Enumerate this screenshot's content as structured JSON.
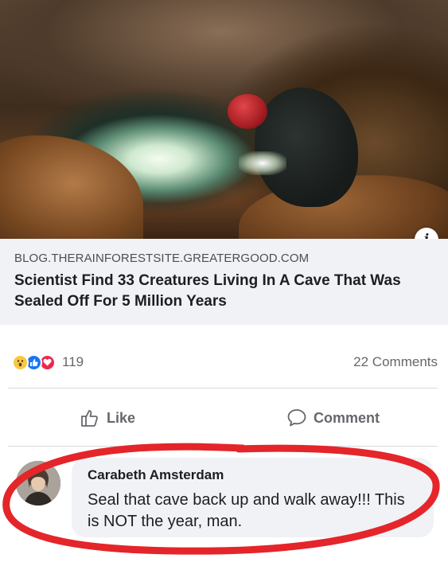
{
  "post": {
    "image_alt": "cave diver",
    "domain": "BLOG.THERAINFORESTSITE.GREATERGOOD.COM",
    "headline": "Scientist Find 33 Creatures Living In A Cave That Was Sealed Off For 5 Million Years",
    "info_icon": "i"
  },
  "reactions": {
    "icons": [
      "wow-icon",
      "like-icon",
      "love-icon"
    ],
    "count": "119",
    "comments": "22 Comments"
  },
  "actions": {
    "like_label": "Like",
    "comment_label": "Comment"
  },
  "comment": {
    "author": "Carabeth Amsterdam",
    "text": "Seal that cave back up and walk away!!! This is NOT the year, man."
  },
  "colors": {
    "link_bg": "#f0f2f5",
    "like_blue": "#1877f2",
    "love_red": "#f0284a",
    "wow_yellow": "#f7c845",
    "annotation_red": "#e4252a"
  }
}
